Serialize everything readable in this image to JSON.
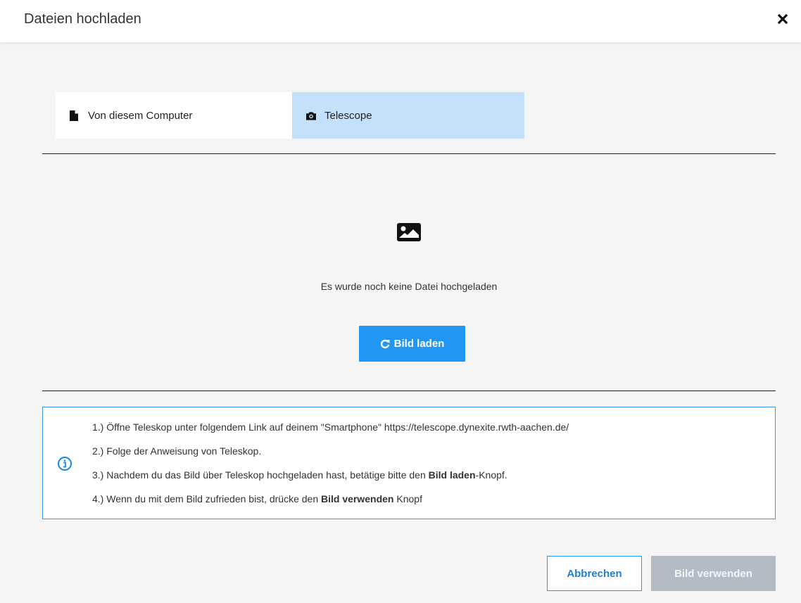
{
  "dialog": {
    "title": "Dateien hochladen",
    "close_icon": "close-icon"
  },
  "tabs": [
    {
      "label": "Von diesem Computer",
      "icon": "file-icon",
      "active": false
    },
    {
      "label": "Telescope",
      "icon": "camera-icon",
      "active": true
    }
  ],
  "upload": {
    "placeholder_icon": "image-icon",
    "empty_message": "Es wurde noch keine Datei hochgeladen",
    "load_button": "Bild laden",
    "load_icon": "reload-icon"
  },
  "info": {
    "icon": "info-icon",
    "steps": [
      {
        "text": "1.) Öffne Teleskop unter folgendem Link auf deinem \"Smartphone\" https://telescope.dynexite.rwth-aachen.de/"
      },
      {
        "text": "2.) Folge der Anweisung von Teleskop."
      },
      {
        "prefix": "3.) Nachdem du das Bild über Teleskop hochgeladen hast, betätige bitte den ",
        "bold": "Bild laden",
        "suffix": "-Knopf."
      },
      {
        "prefix": "4.) Wenn du mit dem Bild zufrieden bist, drücke den ",
        "bold": "Bild verwenden",
        "suffix": " Knopf"
      }
    ]
  },
  "footer": {
    "cancel_label": "Abbrechen",
    "use_label": "Bild verwenden"
  },
  "colors": {
    "accent": "#2196f3",
    "active_tab": "#c3e1fb",
    "disabled_button": "#b3bcc5",
    "info_border": "#3a97e8"
  }
}
